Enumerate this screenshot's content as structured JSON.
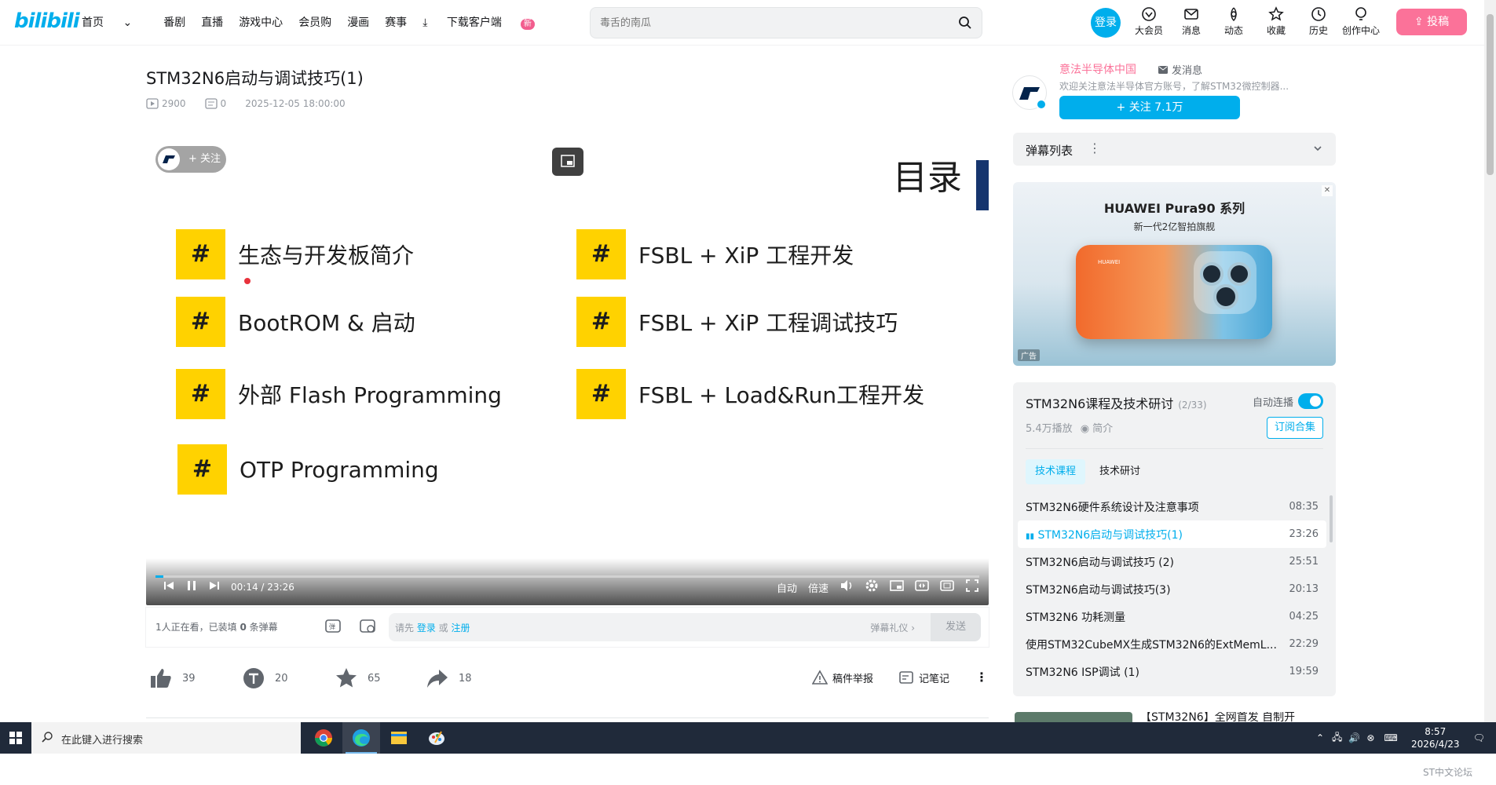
{
  "header": {
    "logo": "bilibili",
    "nav": [
      "首页",
      "番剧",
      "直播",
      "游戏中心",
      "会员购",
      "漫画",
      "赛事"
    ],
    "download": "下载客户端",
    "download_badge": "新",
    "search_placeholder": "毒舌的南瓜",
    "login": "登录",
    "icons": [
      {
        "label": "大会员",
        "icon": "vip-icon"
      },
      {
        "label": "消息",
        "icon": "message-icon"
      },
      {
        "label": "动态",
        "icon": "dynamic-icon"
      },
      {
        "label": "收藏",
        "icon": "favorite-icon"
      },
      {
        "label": "历史",
        "icon": "history-icon"
      },
      {
        "label": "创作中心",
        "icon": "creator-icon"
      }
    ],
    "upload": "投稿"
  },
  "video": {
    "title": "STM32N6启动与调试技巧(1)",
    "views": "2900",
    "danmaku_count": "0",
    "date": "2025-12-05 18:00:00"
  },
  "slide": {
    "title": "目录",
    "items": [
      {
        "mark": "#",
        "text": "生态与开发板简介"
      },
      {
        "mark": "#",
        "text": "BootROM & 启动"
      },
      {
        "mark": "#",
        "text": "外部 Flash Programming"
      },
      {
        "mark": "#",
        "text": "OTP Programming"
      },
      {
        "mark": "#",
        "text": "FSBL + XiP 工程开发"
      },
      {
        "mark": "#",
        "text": "FSBL + XiP 工程调试技巧"
      },
      {
        "mark": "#",
        "text": "FSBL + Load&Run工程开发"
      }
    ]
  },
  "player": {
    "follow": "+ 关注",
    "time": "00:14 / 23:26",
    "progress": 0.01,
    "quality": "自动",
    "speed": "倍速"
  },
  "danmaku_bar": {
    "viewers_pre": "1人正在看，已装填 ",
    "viewers_count": "0",
    "viewers_post": " 条弹幕",
    "input_pre": "请先 ",
    "login": "登录",
    "or": " 或 ",
    "register": "注册",
    "etiquette": "弹幕礼仪 ›",
    "send": "发送"
  },
  "toolbar": {
    "like": "39",
    "coin": "20",
    "favorite": "65",
    "share": "18",
    "report": "稿件举报",
    "note": "记笔记"
  },
  "uploader": {
    "name": "意法半导体中国",
    "message": "发消息",
    "desc": "欢迎关注意法半导体官方账号，了解STM32微控制器...",
    "follow": "+ 关注 7.1万"
  },
  "danmaku_list": {
    "title": "弹幕列表"
  },
  "ad": {
    "brand": "HUAWEI Pura90 系列",
    "slogan": "新一代2亿智拍旗舰",
    "tag": "广告",
    "phone_brand": "HUAWEI"
  },
  "collection": {
    "title": "STM32N6课程及技术研讨",
    "count": "(2/33)",
    "autoplay": "自动连播",
    "plays": "5.4万播放",
    "intro": "简介",
    "subscribe": "订阅合集",
    "tabs": [
      "技术课程",
      "技术研讨"
    ],
    "episodes": [
      {
        "title": "STM32N6硬件系统设计及注意事项",
        "duration": "08:35"
      },
      {
        "title": "STM32N6启动与调试技巧(1)",
        "duration": "23:26"
      },
      {
        "title": "STM32N6启动与调试技巧 (2)",
        "duration": "25:51"
      },
      {
        "title": "STM32N6启动与调试技巧(3)",
        "duration": "20:13"
      },
      {
        "title": "STM32N6 功耗测量",
        "duration": "04:25"
      },
      {
        "title": "使用STM32CubeMX生成STM32N6的ExtMemL...",
        "duration": "22:29"
      },
      {
        "title": "STM32N6 ISP调试 (1)",
        "duration": "19:59"
      }
    ]
  },
  "recommend": {
    "title": "【STM32N6】全网首发 自制开"
  },
  "taskbar": {
    "search": "在此键入进行搜索",
    "time": "8:57",
    "date": "2026/4/23"
  },
  "watermark": "ST中文论坛"
}
